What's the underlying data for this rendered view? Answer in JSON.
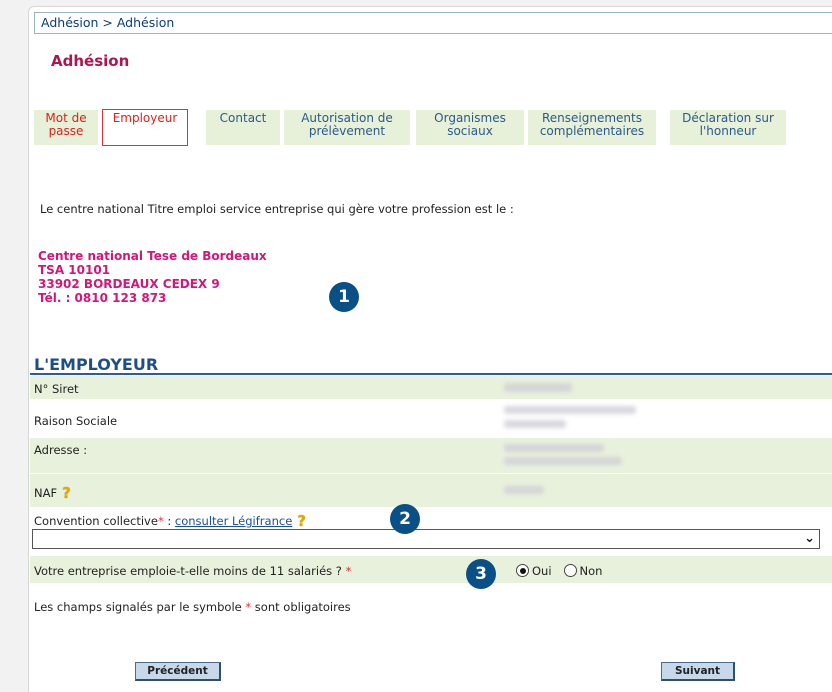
{
  "breadcrumb": "Adhésion > Adhésion",
  "title": "Adhésion",
  "tabs": [
    {
      "label": "Mot de passe"
    },
    {
      "label": "Employeur"
    },
    {
      "label": "Contact"
    },
    {
      "label": "Autorisation de prélèvement"
    },
    {
      "label": "Organismes sociaux"
    },
    {
      "label": "Renseignements complémentaires"
    },
    {
      "label": "Déclaration sur l'honneur"
    }
  ],
  "intro": "Le centre national Titre emploi service entreprise qui gère votre profession est le :",
  "center": {
    "name": "Centre national Tese de Bordeaux",
    "address1": "TSA 10101",
    "address2": "33902 BORDEAUX CEDEX 9",
    "phone": "Tél. : 0810 123 873"
  },
  "badges": [
    "1",
    "2",
    "3"
  ],
  "section_title": "L'EMPLOYEUR",
  "fields": {
    "siret_label": "N° Siret",
    "raison_label": "Raison Sociale",
    "adresse_label": "Adresse :",
    "naf_label": "NAF",
    "convention_label": "Convention collective",
    "convention_sep": " : ",
    "convention_link": "consulter Légifrance",
    "required_mark": "*",
    "employees_question": "Votre entreprise emploie-t-elle moins de 11 salariés ?",
    "radio_yes": "Oui",
    "radio_no": "Non",
    "radio_selected": "Oui"
  },
  "note": {
    "before": "Les champs signalés par le symbole ",
    "after": " sont obligatoires"
  },
  "buttons": {
    "previous": "Précédent",
    "next": "Suivant"
  },
  "icons": {
    "help": "question-mark-icon",
    "select": "chevron-down-icon"
  },
  "colors": {
    "title": "#b0154e",
    "center_text": "#d0187a",
    "section_title": "#1e4e86",
    "badge": "#0b4f87",
    "row_green": "#e8f1dc",
    "tab_bg": "#e7f0d8",
    "active_tab_border": "#e0303a"
  }
}
